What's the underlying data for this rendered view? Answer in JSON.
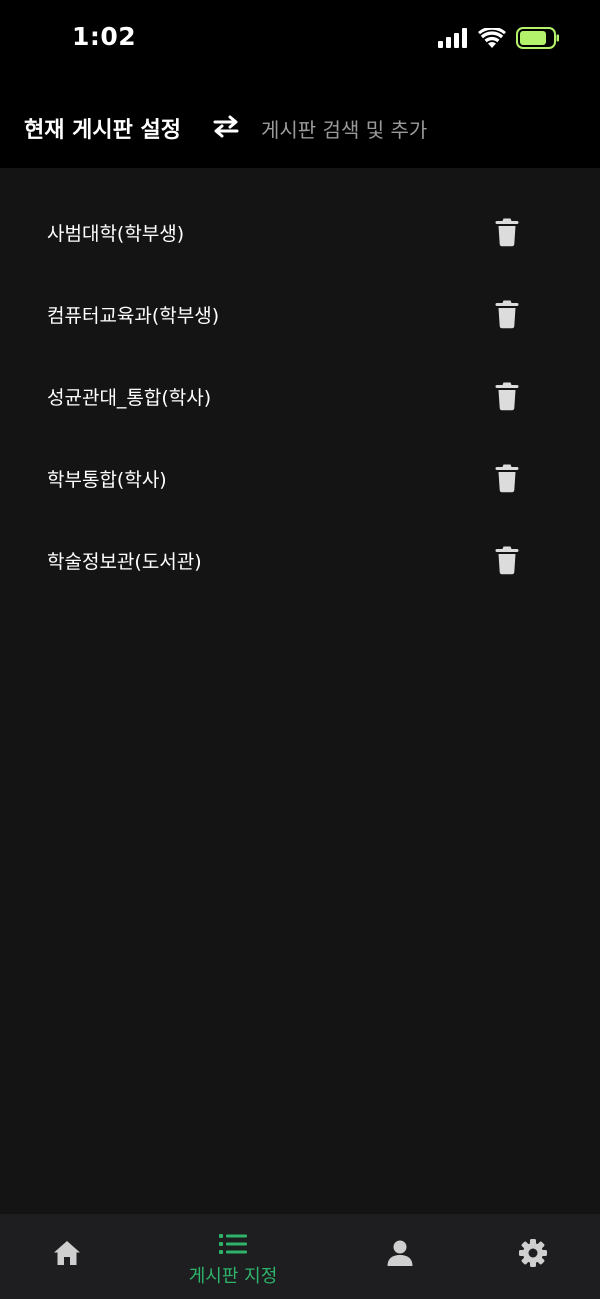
{
  "status_bar": {
    "time": "1:02"
  },
  "header": {
    "title": "현재 게시판 설정",
    "swap_icon": "swap-arrows-icon",
    "search_add_link": "게시판 검색 및 추가"
  },
  "boards": [
    {
      "label": "사범대학(학부생)"
    },
    {
      "label": "컴퓨터교육과(학부생)"
    },
    {
      "label": "성균관대_통합(학사)"
    },
    {
      "label": "학부통합(학사)"
    },
    {
      "label": "학술정보관(도서관)"
    }
  ],
  "bottom_nav": {
    "items": [
      {
        "icon": "home-icon",
        "label": ""
      },
      {
        "icon": "list-icon",
        "label": "게시판 지정",
        "active": true
      },
      {
        "icon": "person-icon",
        "label": ""
      },
      {
        "icon": "gear-icon",
        "label": ""
      }
    ]
  },
  "colors": {
    "background": "#141414",
    "header_background": "#000000",
    "nav_background": "#1e1e20",
    "accent": "#2db36a",
    "muted_text": "#9a9a9a",
    "battery": "#b5f26b"
  }
}
